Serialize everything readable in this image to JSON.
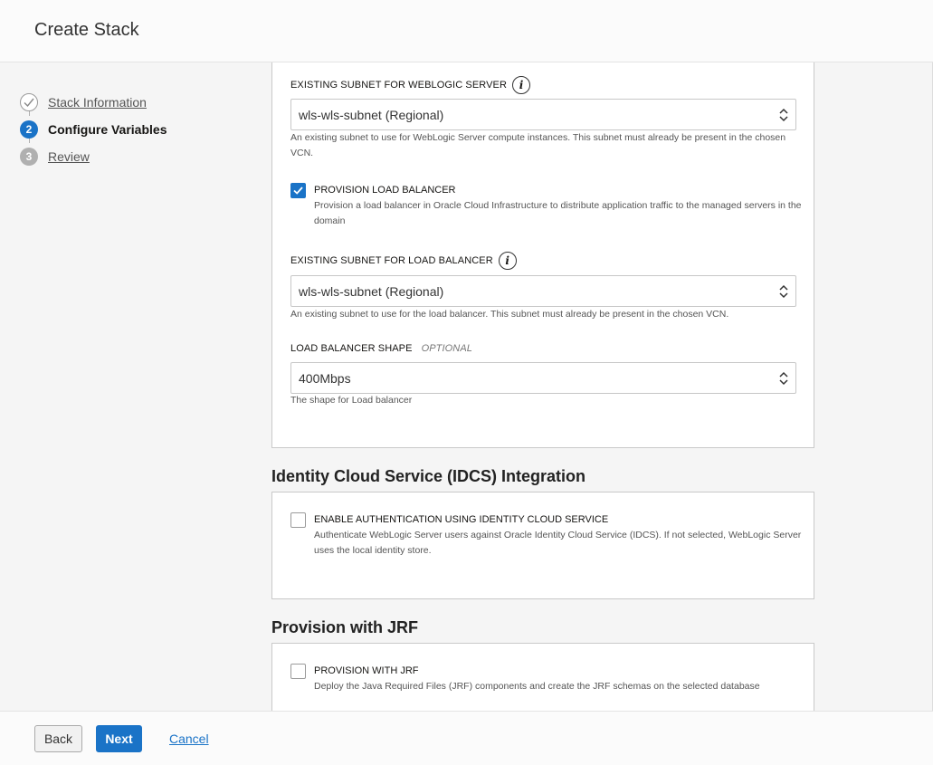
{
  "header": {
    "title": "Create Stack"
  },
  "steps": [
    {
      "number": "1",
      "label": "Stack Information",
      "state": "done"
    },
    {
      "number": "2",
      "label": "Configure Variables",
      "state": "current"
    },
    {
      "number": "3",
      "label": "Review",
      "state": "future"
    }
  ],
  "weblogic_section": {
    "subnet_wls": {
      "label": "EXISTING SUBNET FOR WEBLOGIC SERVER",
      "value": "wls-wls-subnet (Regional)",
      "help": "An existing subnet to use for WebLogic Server compute instances. This subnet must already be present in the chosen VCN."
    },
    "provision_lb": {
      "label": "PROVISION LOAD BALANCER",
      "checked": true,
      "help": "Provision a load balancer in Oracle Cloud Infrastructure to distribute application traffic to the managed servers in the domain"
    },
    "subnet_lb": {
      "label": "EXISTING SUBNET FOR LOAD BALANCER",
      "value": "wls-wls-subnet (Regional)",
      "help": "An existing subnet to use for the load balancer. This subnet must already be present in the chosen VCN."
    },
    "lb_shape": {
      "label": "LOAD BALANCER SHAPE",
      "optional": "OPTIONAL",
      "value": "400Mbps",
      "help": "The shape for Load balancer"
    }
  },
  "idcs_section": {
    "title": "Identity Cloud Service (IDCS) Integration",
    "enable_auth": {
      "label": "ENABLE AUTHENTICATION USING IDENTITY CLOUD SERVICE",
      "checked": false,
      "help": "Authenticate WebLogic Server users against Oracle Identity Cloud Service (IDCS). If not selected, WebLogic Server uses the local identity store."
    }
  },
  "jrf_section": {
    "title": "Provision with JRF",
    "provision_jrf": {
      "label": "PROVISION WITH JRF",
      "checked": false,
      "help": "Deploy the Java Required Files (JRF) components and create the JRF schemas on the selected database"
    }
  },
  "footer": {
    "back_label": "Back",
    "next_label": "Next",
    "cancel_label": "Cancel"
  },
  "colors": {
    "accent": "#1a73c7"
  }
}
